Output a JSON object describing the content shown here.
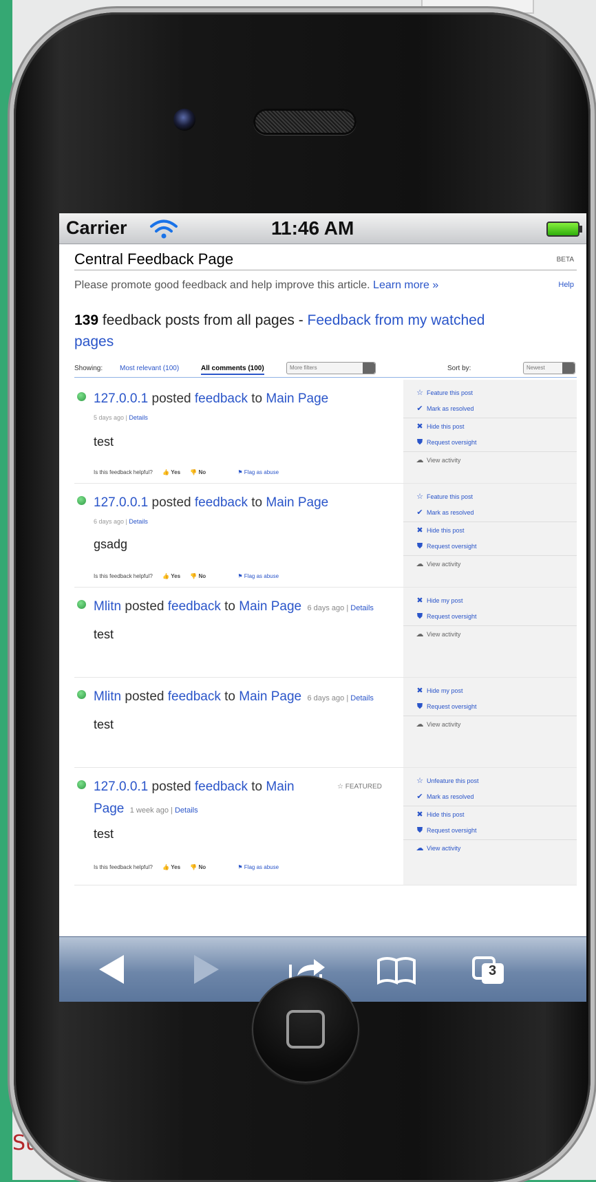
{
  "status": {
    "carrier": "Carrier",
    "time": "11:46 AM"
  },
  "page": {
    "title": "Central Feedback Page",
    "beta": "BETA",
    "intro": "Please promote good feedback and help improve this article.",
    "learn_more": "Learn more »",
    "help": "Help",
    "count": "139",
    "count_text": " feedback posts from all pages",
    "separator": " - ",
    "watched_link": "Feedback from my watched pages"
  },
  "filters": {
    "showing_label": "Showing:",
    "most_relevant": "Most relevant (100)",
    "all_comments": "All comments (100)",
    "more_filters": "More filters",
    "sort_label": "Sort by:",
    "sort_value": "Newest"
  },
  "posts": [
    {
      "user": "127.0.0.1",
      "posted": "posted",
      "feedback": "feedback",
      "to": "to",
      "page": "Main Page",
      "time": "5 days ago",
      "details": "Details",
      "text": "test",
      "helpful": "Is this feedback helpful?",
      "yes": "Yes",
      "no": "No",
      "flag": "Flag as abuse",
      "actions": [
        "Feature this post",
        "Mark as resolved",
        "Hide this post",
        "Request oversight",
        "View activity"
      ]
    },
    {
      "user": "127.0.0.1",
      "posted": "posted",
      "feedback": "feedback",
      "to": "to",
      "page": "Main Page",
      "time": "6 days ago",
      "details": "Details",
      "text": "gsadg",
      "helpful": "Is this feedback helpful?",
      "yes": "Yes",
      "no": "No",
      "flag": "Flag as abuse",
      "actions": [
        "Feature this post",
        "Mark as resolved",
        "Hide this post",
        "Request oversight",
        "View activity"
      ]
    },
    {
      "user": "Mlitn",
      "posted": "posted",
      "feedback": "feedback",
      "to": "to",
      "page": "Main Page",
      "time": "6 days ago",
      "details": "Details",
      "text": "test",
      "actions": [
        "Hide my post",
        "Request oversight",
        "View activity"
      ]
    },
    {
      "user": "Mlitn",
      "posted": "posted",
      "feedback": "feedback",
      "to": "to",
      "page": "Main Page",
      "time": "6 days ago",
      "details": "Details",
      "text": "test",
      "actions": [
        "Hide my post",
        "Request oversight",
        "View activity"
      ]
    },
    {
      "user": "127.0.0.1",
      "posted": "posted",
      "feedback": "feedback",
      "to": "to",
      "page": "Main Page",
      "time": "1 week ago",
      "details": "Details",
      "text": "test",
      "featured": "FEATURED",
      "helpful": "Is this feedback helpful?",
      "yes": "Yes",
      "no": "No",
      "flag": "Flag as abuse",
      "actions": [
        "Unfeature this post",
        "Mark as resolved",
        "Hide this post",
        "Request oversight",
        "View activity"
      ]
    }
  ],
  "toolbar": {
    "tabs_count": "3"
  },
  "desk": {
    "corner_text": "Su"
  }
}
